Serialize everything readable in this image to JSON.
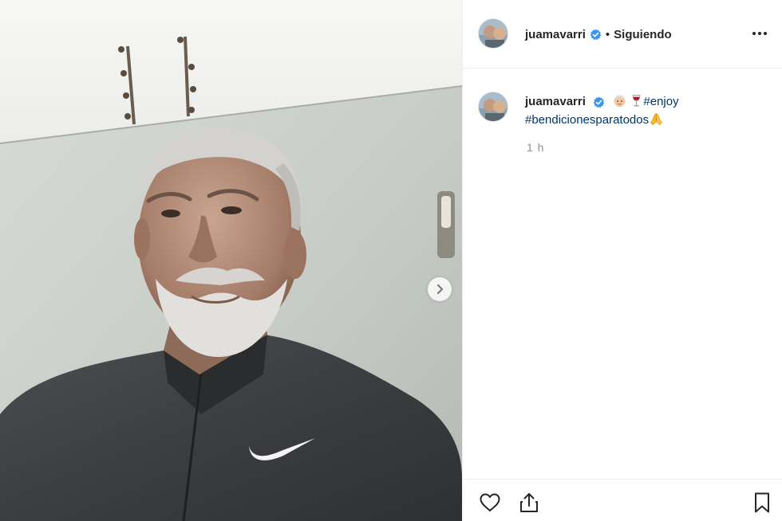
{
  "post": {
    "username": "juamavarri",
    "follow_status": "Siguiendo",
    "separator": "•",
    "caption": {
      "username": "juamavarri",
      "hashtag_enjoy": "#enjoy",
      "hashtag_bendiciones": "#bendicionesparatodos",
      "emojis": [
        "older-man-emoji",
        "wine-glass-emoji",
        "folded-hands-emoji"
      ]
    },
    "timestamp": "1 h"
  },
  "icons": {
    "verified": "verified-badge-icon",
    "more": "more-options-icon",
    "next": "chevron-right-icon",
    "like": "heart-icon",
    "share": "share-icon",
    "save": "bookmark-icon"
  },
  "colors": {
    "verified_blue": "#3897f0",
    "hashtag_blue": "#003569",
    "text": "#262626",
    "muted": "#8e8e8e",
    "divider": "#efefef"
  }
}
